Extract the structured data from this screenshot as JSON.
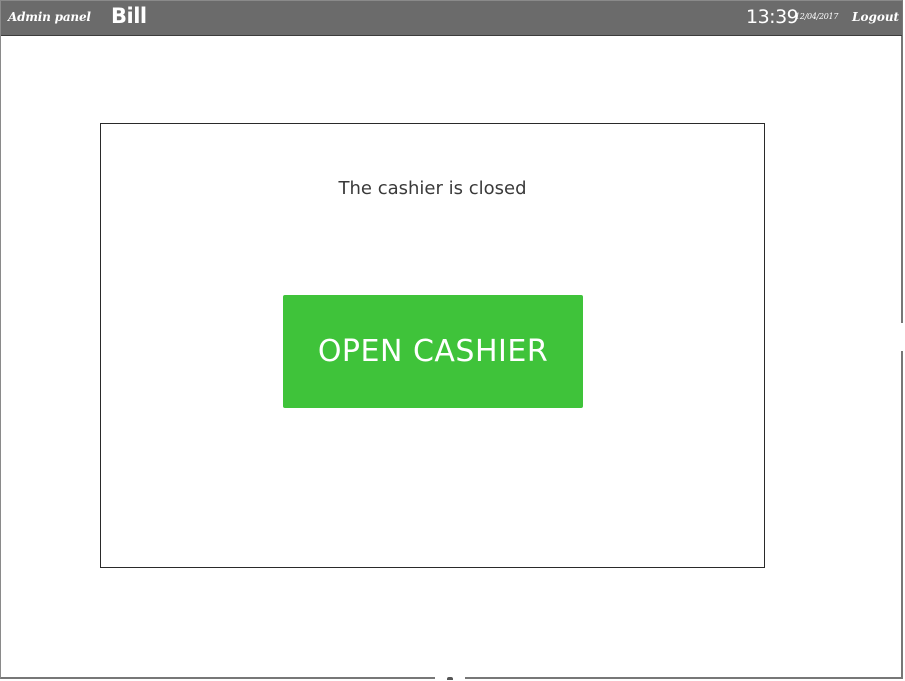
{
  "header": {
    "admin_link": "Admin panel",
    "app_title": "Bill",
    "time": "13:39",
    "date": "12/04/2017",
    "logout_label": "Logout"
  },
  "cashier": {
    "status_text": "The cashier is closed",
    "open_button_label": "OPEN CASHIER"
  },
  "colors": {
    "topbar": "#6b6b6b",
    "open_button": "#3fc33a"
  }
}
